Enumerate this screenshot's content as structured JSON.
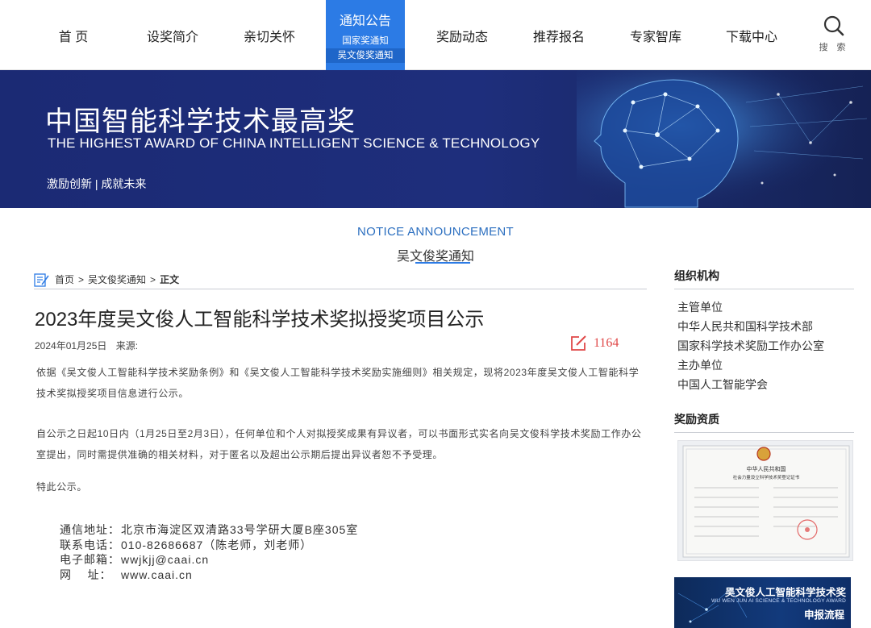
{
  "nav": {
    "items": [
      "首 页",
      "设奖简介",
      "亲切关怀",
      "奖励动态",
      "推荐报名",
      "专家智库",
      "下载中心"
    ],
    "active": {
      "label": "通知公告",
      "sub": [
        "国家奖通知",
        "吴文俊奖通知"
      ]
    },
    "search_label": "搜 索"
  },
  "banner": {
    "title": "中国智能科学技术最高奖",
    "title_en": "THE HIGHEST AWARD OF CHINA INTELLIGENT SCIENCE & TECHNOLOGY",
    "slogan": "激励创新 | 成就未来"
  },
  "section": {
    "en": "NOTICE ANNOUNCEMENT",
    "cn": "吴文俊奖通知"
  },
  "breadcrumb": {
    "home": "首页",
    "sep": ">",
    "category": "吴文俊奖通知",
    "current": "正文"
  },
  "article": {
    "title": "2023年度吴文俊人工智能科学技术奖拟授奖项目公示",
    "date": "2024年01月25日",
    "source": "来源:",
    "views": "1164",
    "p1": "依据《吴文俊人工智能科学技术奖励条例》和《吴文俊人工智能科学技术奖励实施细则》相关规定，现将2023年度吴文俊人工智能科学技术奖拟授奖项目信息进行公示。",
    "p2": "自公示之日起10日内（1月25日至2月3日），任何单位和个人对拟授奖成果有异议者，可以书面形式实名向吴文俊科学技术奖励工作办公室提出，同时需提供准确的相关材料，对于匿名以及超出公示期后提出异议者恕不予受理。",
    "p3": "特此公示。",
    "contact": [
      {
        "label": "通信地址：",
        "value": "北京市海淀区双清路33号学研大厦B座305室"
      },
      {
        "label": "联系电话：",
        "value": "010-82686687（陈老师，刘老师）"
      },
      {
        "label": "电子邮箱：",
        "value": "wwjkjj@caai.cn"
      },
      {
        "label": "网    址：",
        "value": "www.caai.cn"
      }
    ]
  },
  "sidebar": {
    "org_title": "组织机构",
    "org_items": [
      "主管单位",
      "中华人民共和国科学技术部",
      "国家科学技术奖励工作办公室",
      "主办单位",
      "中国人工智能学会"
    ],
    "qual_title": "奖励资质",
    "cert_title": "中华人民共和国",
    "cert_sub": "社会力量设立科学技术奖登记证书",
    "promo_title": "吴文俊人工智能科学技术奖",
    "promo_en": "WU WEN JUN AI SCIENCE & TECHNOLOGY AWARD",
    "promo_sub": "申报流程"
  },
  "colors": {
    "accent": "#2c7be5",
    "banner": "#1e2e7c",
    "views": "#e04848"
  }
}
